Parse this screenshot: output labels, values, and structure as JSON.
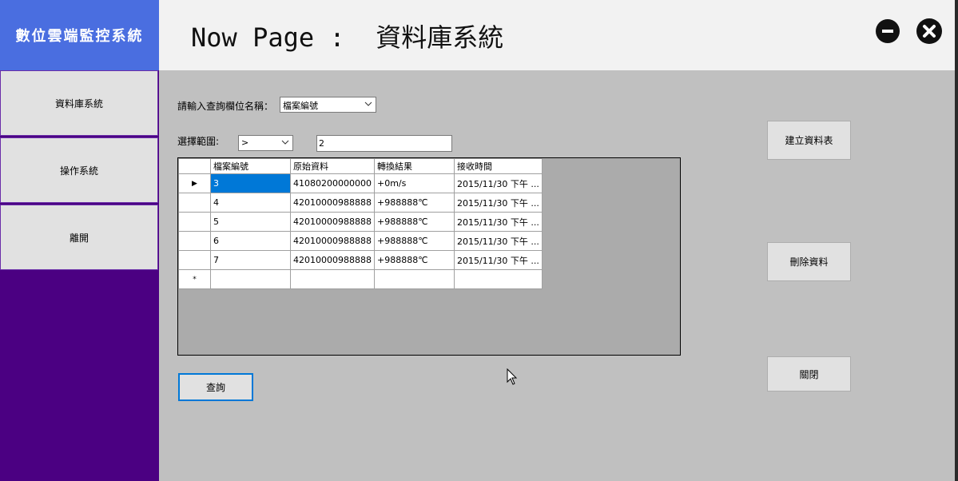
{
  "app": {
    "title": "數位雲端監控系統"
  },
  "sidebar": {
    "items": [
      {
        "label": "資料庫系統"
      },
      {
        "label": "操作系統"
      },
      {
        "label": "離開"
      }
    ]
  },
  "header": {
    "page_title": "Now Page :  資料庫系統",
    "minimize_icon": "minus-circle-icon",
    "close_icon": "x-circle-icon"
  },
  "query": {
    "field_label": "請輸入查詢欄位名稱：",
    "field_value": "檔案編號",
    "range_label": "選擇範圍:",
    "operator_value": ">",
    "range_value": "2",
    "search_button": "查詢"
  },
  "grid": {
    "columns": [
      "檔案編號",
      "原始資料",
      "轉換結果",
      "接收時間"
    ],
    "rows": [
      [
        "3",
        "41080200000000",
        "+0m/s",
        "2015/11/30 下午 ..."
      ],
      [
        "4",
        "42010000988888",
        "+988888℃",
        "2015/11/30 下午 ..."
      ],
      [
        "5",
        "42010000988888",
        "+988888℃",
        "2015/11/30 下午 ..."
      ],
      [
        "6",
        "42010000988888",
        "+988888℃",
        "2015/11/30 下午 ..."
      ],
      [
        "7",
        "42010000988888",
        "+988888℃",
        "2015/11/30 下午 ..."
      ]
    ],
    "current_row_marker": "▶",
    "new_row_marker": "*"
  },
  "actions": {
    "create_table": "建立資料表",
    "delete_data": "刪除資料",
    "close": "關閉"
  },
  "colors": {
    "brand": "#4a6ee0",
    "sidebar": "#4b0082",
    "selection": "#0078d7",
    "background": "#c0c0c0"
  }
}
